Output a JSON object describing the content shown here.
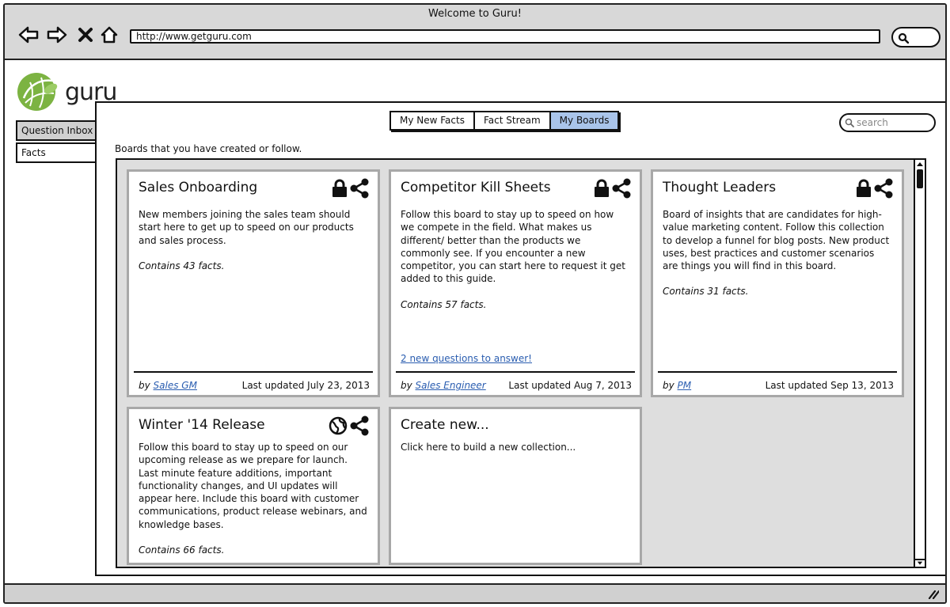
{
  "window": {
    "title": "Welcome to Guru!",
    "url": "http://www.getguru.com"
  },
  "brand": {
    "name": "guru",
    "logo_color": "#7cb342"
  },
  "sidebar": {
    "tabs": [
      {
        "label": "Question Inbox"
      },
      {
        "label": "Facts"
      }
    ]
  },
  "nav": {
    "segments": [
      {
        "label": "My New Facts",
        "active": false
      },
      {
        "label": "Fact Stream",
        "active": false
      },
      {
        "label": "My Boards",
        "active": true
      }
    ],
    "active_color": "#a9c4ea"
  },
  "search": {
    "placeholder": "search"
  },
  "main": {
    "subtitle": "Boards that you have created or follow."
  },
  "boards": [
    {
      "title": "Sales Onboarding",
      "privacy_icon": "lock-icon",
      "description": "New members joining the sales team should start here to get up to speed on our products and sales process.",
      "count": "Contains 43 facts.",
      "by_prefix": "by",
      "author": "Sales GM",
      "updated": "Last updated July 23, 2013"
    },
    {
      "title": "Competitor Kill Sheets",
      "privacy_icon": "lock-icon",
      "description": "Follow this board to stay up to speed on how we compete in the field.  What makes us different/ better than the products we commonly see.  If you encounter a new competitor, you can start here to request it get added to this guide.",
      "count": "Contains 57 facts.",
      "link": "2 new questions to answer!",
      "by_prefix": "by",
      "author": "Sales Engineer",
      "updated": "Last updated Aug 7, 2013"
    },
    {
      "title": "Thought Leaders",
      "privacy_icon": "lock-icon",
      "description": "Board of insights that are candidates for high-value marketing content.  Follow this collection to develop a funnel for blog posts.  New product uses, best practices and customer scenarios are things you will find in this board.",
      "count": "Contains 31 facts.",
      "by_prefix": "by",
      "author": "PM",
      "updated": "Last updated Sep 13, 2013"
    },
    {
      "title": "Winter '14 Release",
      "privacy_icon": "globe-icon",
      "description": "Follow this board to stay up to speed on our upcoming release as we prepare for launch.  Last minute feature additions, important functionality changes, and UI updates will appear here.  Include this board with customer communications, product release webinars, and knowledge bases.",
      "count": "Contains 66 facts."
    }
  ],
  "create_card": {
    "title": "Create new...",
    "description": "Click here to build a new collection..."
  }
}
